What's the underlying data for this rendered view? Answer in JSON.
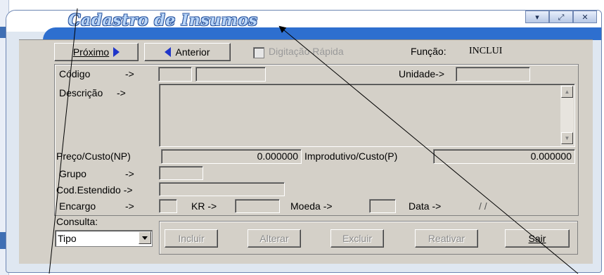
{
  "window": {
    "title": "Cadastro de Insumos",
    "buttons": [
      "▾",
      "⤢",
      "✕"
    ]
  },
  "nav": {
    "next_label": "Próximo",
    "prev_label": "Anterior",
    "quick_entry_label": "Digitação Rápida",
    "function_label": "Função:",
    "function_value": "INCLUI"
  },
  "fields": {
    "codigo_label": "Código",
    "codigo_arrow": "->",
    "unidade_label": "Unidade->",
    "descricao_label": "Descrição",
    "descricao_arrow": "->",
    "preco_label": "Preço/Custo(NP)",
    "preco_value": "0.000000",
    "improdutivo_label": "Improdutivo/Custo(P)",
    "improdutivo_value": "0.000000",
    "grupo_label": "Grupo",
    "grupo_arrow": "->",
    "cod_estendido_label": "Cod.Estendido ->",
    "encargo_label": "Encargo",
    "encargo_arrow": "->",
    "kr_label": "KR ->",
    "moeda_label": "Moeda ->",
    "data_label": "Data ->",
    "data_value": "/ /"
  },
  "consulta": {
    "label": "Consulta:",
    "selected": "Tipo"
  },
  "actions": {
    "incluir": "Incluir",
    "alterar": "Alterar",
    "excluir": "Excluir",
    "reativar": "Reativar",
    "sair": "Sair"
  },
  "colors": {
    "title_band": "#2e6fcf",
    "face": "#d4d0c8",
    "arrow_blue": "#1f35c9"
  }
}
